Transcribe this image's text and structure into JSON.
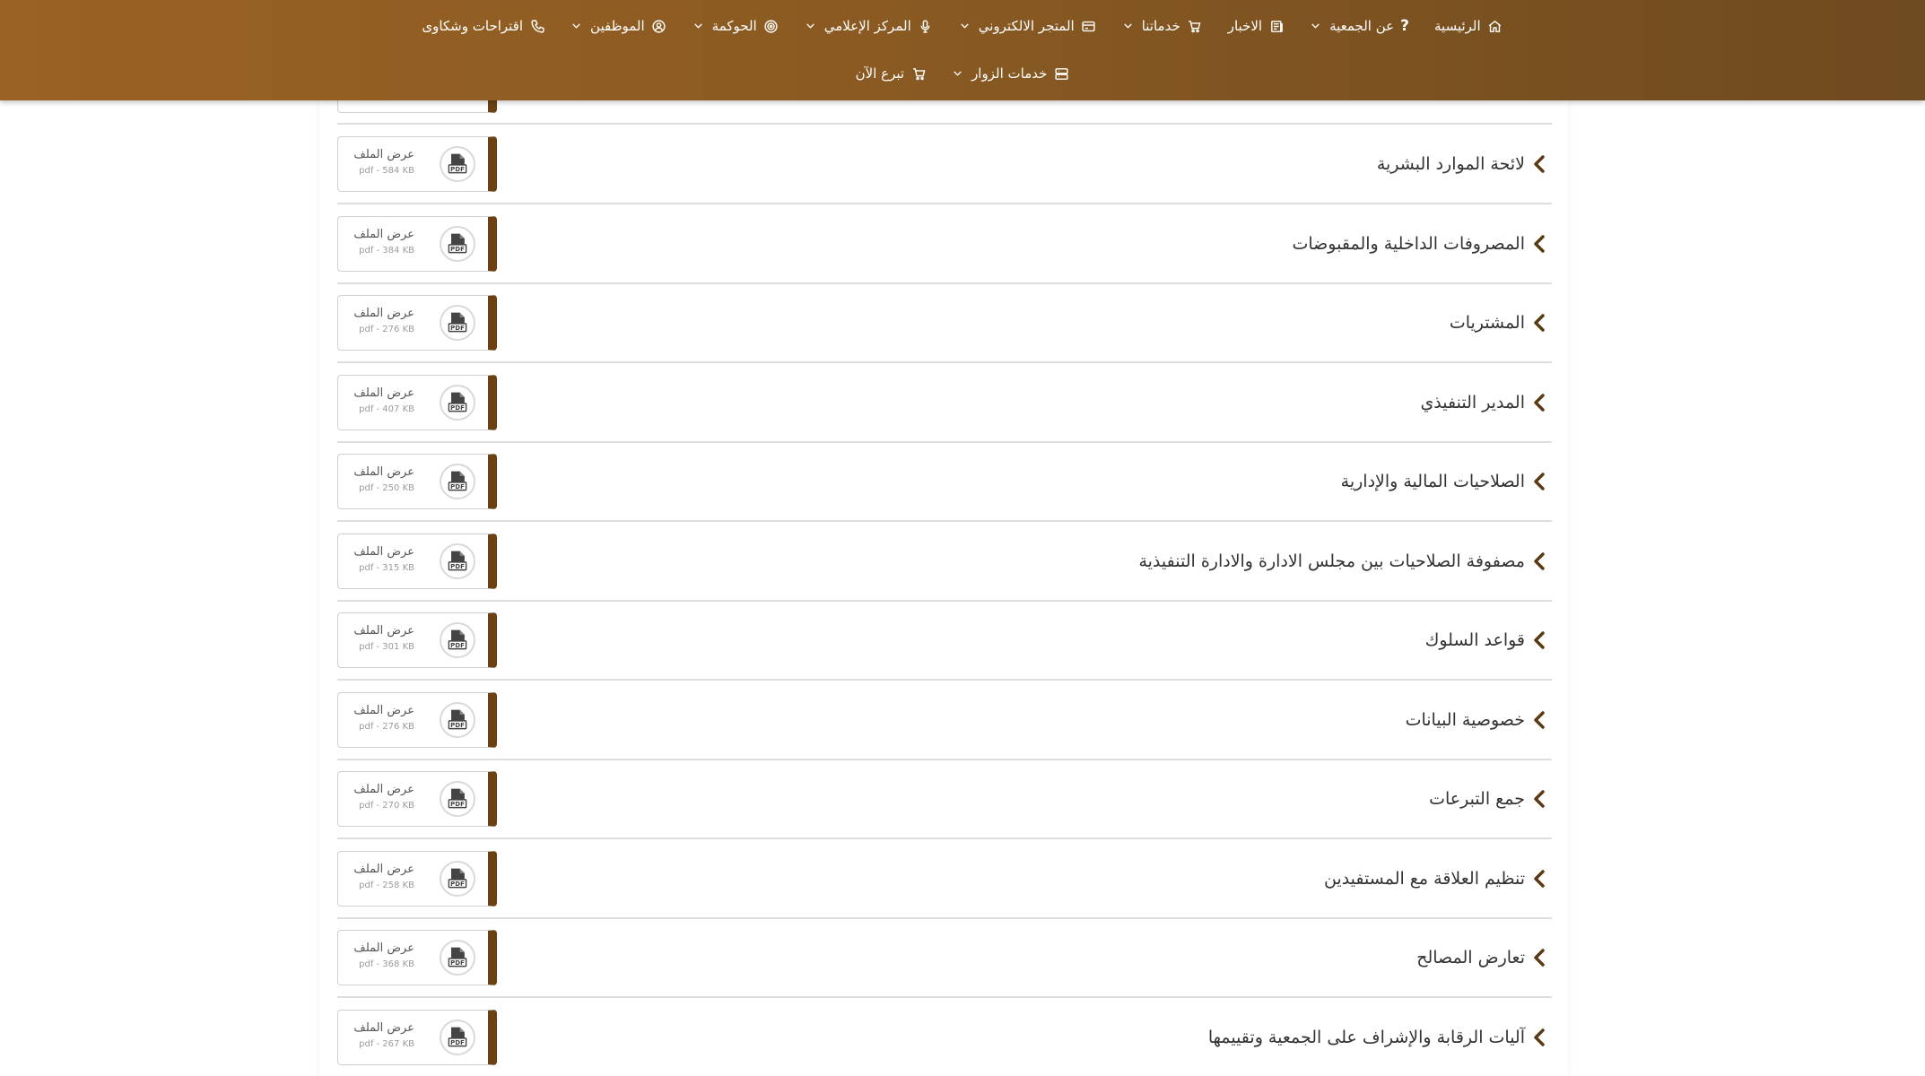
{
  "nav": {
    "row1": [
      {
        "label": "الرئيسية",
        "icon": "home-icon",
        "dropdown": false
      },
      {
        "label": "عن الجمعية",
        "icon": "question-icon",
        "dropdown": true
      },
      {
        "label": "الاخبار",
        "icon": "newspaper-icon",
        "dropdown": false
      },
      {
        "label": "خدماتنا",
        "icon": "cart-icon",
        "dropdown": true
      },
      {
        "label": "المتجر الالكتروني",
        "icon": "card-icon",
        "dropdown": true
      },
      {
        "label": "المركز الإعلامي",
        "icon": "microphone-icon",
        "dropdown": true
      },
      {
        "label": "الحوكمة",
        "icon": "target-icon",
        "dropdown": true
      },
      {
        "label": "الموظفين",
        "icon": "user-circle-icon",
        "dropdown": true
      },
      {
        "label": "اقتراحات وشكاوى",
        "icon": "phone-icon",
        "dropdown": false
      }
    ],
    "row2": [
      {
        "label": "خدمات الزوار",
        "icon": "server-icon",
        "dropdown": true
      },
      {
        "label": "تبرع الآن",
        "icon": "cart-icon",
        "dropdown": false
      }
    ]
  },
  "file_label": "عرض الملف",
  "documents": [
    {
      "title": "لائحة الموارد البشرية",
      "size": "pdf - 584 KB"
    },
    {
      "title": "المصروفات الداخلية والمقبوضات",
      "size": "pdf - 384 KB"
    },
    {
      "title": "المشتريات",
      "size": "pdf - 276 KB"
    },
    {
      "title": "المدير التنفيذي",
      "size": "pdf - 407 KB"
    },
    {
      "title": "الصلاحيات المالية والإدارية",
      "size": "pdf - 250 KB"
    },
    {
      "title": "مصفوفة الصلاحيات بين مجلس الادارة والادارة التنفيذية",
      "size": "pdf - 315 KB"
    },
    {
      "title": "قواعد السلوك",
      "size": "pdf - 301 KB"
    },
    {
      "title": "خصوصية البيانات",
      "size": "pdf - 276 KB"
    },
    {
      "title": "جمع التبرعات",
      "size": "pdf - 270 KB"
    },
    {
      "title": "تنظيم العلاقة مع المستفيدين",
      "size": "pdf - 258 KB"
    },
    {
      "title": "تعارض المصالح",
      "size": "pdf - 368 KB"
    },
    {
      "title": "آليات الرقابة والإشراف على الجمعية وتقييمها",
      "size": "pdf - 267 KB"
    }
  ],
  "colors": {
    "header_start": "#9a6224",
    "header_end": "#6e4a1f",
    "accent": "#6b4113"
  }
}
